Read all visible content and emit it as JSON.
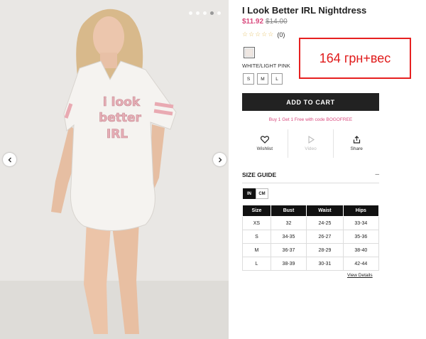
{
  "gallery": {
    "shirt_print": [
      "i look",
      "better",
      "IRL"
    ],
    "dot_count": 5,
    "active_dot": 3
  },
  "product": {
    "title": "I Look Better IRL Nightdress",
    "sale_price": "$11.92",
    "original_price": "$14.00",
    "rating_stars": "☆☆☆☆☆",
    "review_count": "(0)",
    "color_name": "WHITE/LIGHT PINK",
    "sizes": [
      "S",
      "M",
      "L"
    ]
  },
  "cart": {
    "add_label": "ADD TO CART",
    "promo": "Buy 1 Get 1 Free with code BOGOFREE"
  },
  "actions": {
    "wishlist": "Wishlist",
    "video": "Video",
    "share": "Share"
  },
  "size_guide": {
    "heading": "SIZE GUIDE",
    "toggle": "–",
    "units": [
      "IN",
      "CM"
    ],
    "columns": [
      "Size",
      "Bust",
      "Waist",
      "Hips"
    ],
    "rows": [
      [
        "XS",
        "32",
        "24-25",
        "33-34"
      ],
      [
        "S",
        "34-35",
        "26-27",
        "35-36"
      ],
      [
        "M",
        "36-37",
        "28-29",
        "38-40"
      ],
      [
        "L",
        "38-39",
        "30-31",
        "42-44"
      ]
    ],
    "view_details": "View Details"
  },
  "annotation": {
    "text": "164 грн+вес",
    "color": "#e62020"
  },
  "colors": {
    "sale": "#d9497d",
    "button": "#222222",
    "star": "#e6c36a"
  }
}
